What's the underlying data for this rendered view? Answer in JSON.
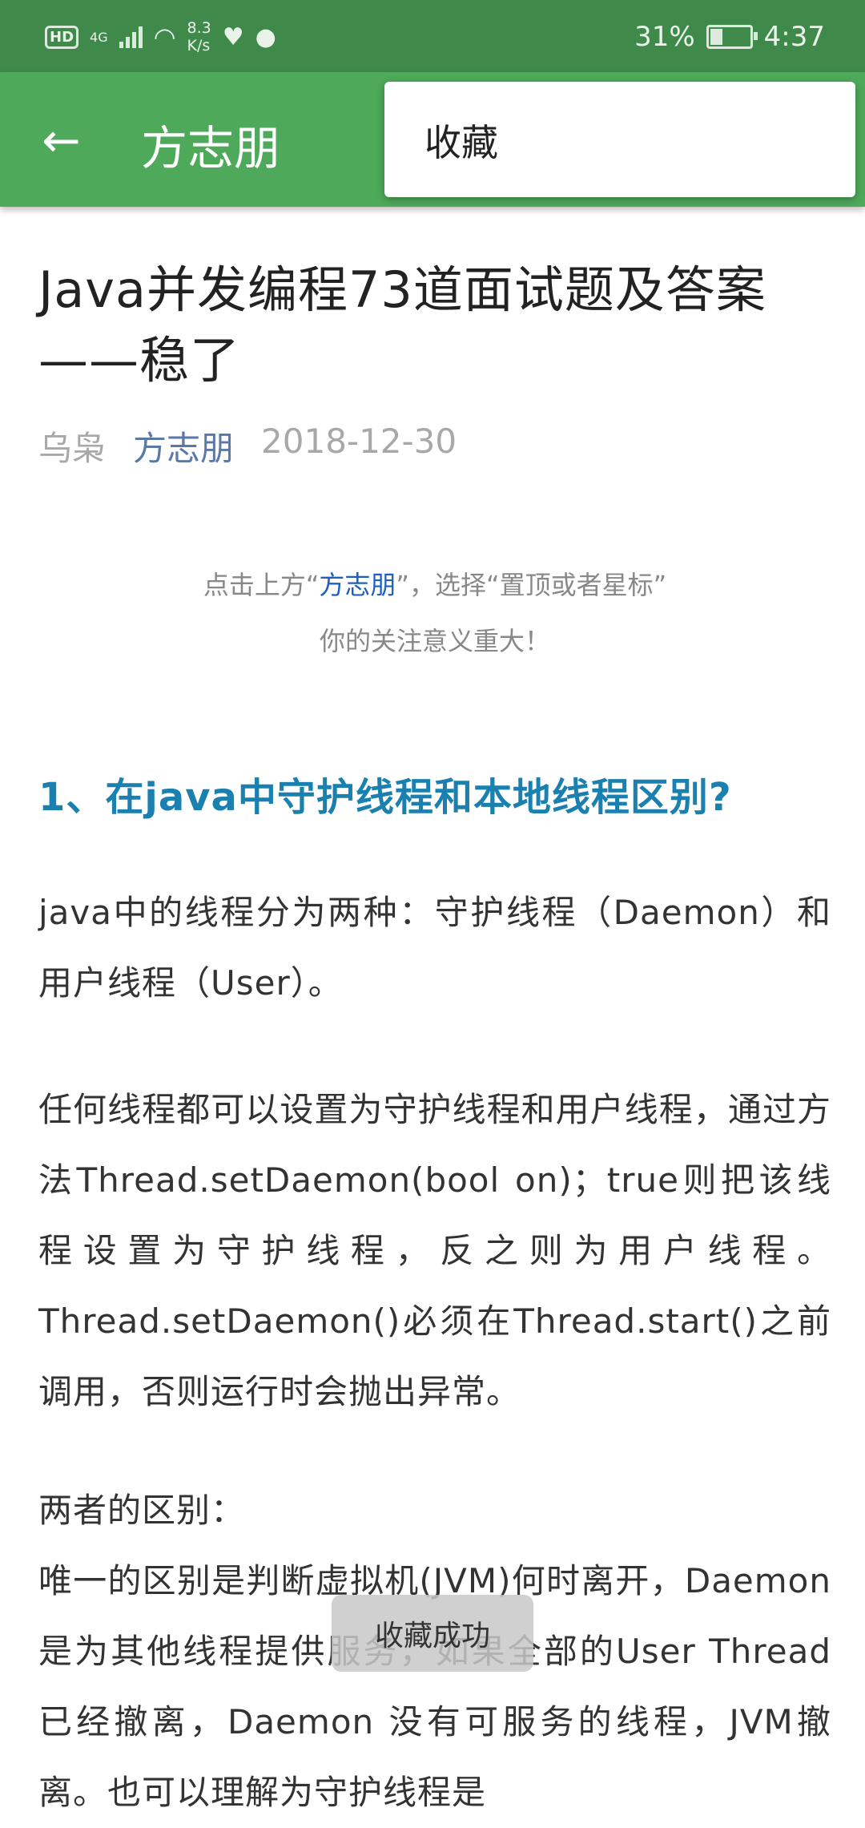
{
  "status_bar": {
    "hd_label": "HD",
    "network": "4G",
    "speed_value": "8.3",
    "speed_unit": "K/s",
    "battery_percent": "31%",
    "time": "4:37"
  },
  "app_bar": {
    "title": "方志朋",
    "menu_item": "收藏"
  },
  "article": {
    "title": "Java并发编程73道面试题及答案——稳了",
    "source": "乌枭",
    "author": "方志朋",
    "date": "2018-12-30",
    "notice_prefix": "点击上方“",
    "notice_link": "方志朋",
    "notice_suffix": "”，选择“置顶或者星标”",
    "notice_line2": "你的关注意义重大！",
    "heading1": "1、在java中守护线程和本地线程区别?",
    "para1": "java中的线程分为两种：守护线程（Daemon）和用户线程（User）。",
    "para2": "任何线程都可以设置为守护线程和用户线程，通过方法Thread.setDaemon(bool on)；true则把该线程设置为守护线程，反之则为用户线程。Thread.setDaemon()必须在Thread.start()之前调用，否则运行时会抛出异常。",
    "para3_label": "两者的区别：",
    "para3": "唯一的区别是判断虚拟机(JVM)何时离开，Daemon是为其他线程提供服务，如果全部的User Thread已经撤离，Daemon 没有可服务的线程，JVM撤离。也可以理解为守护线程是"
  },
  "toast": "收藏成功",
  "colors": {
    "status_bar": "#3f8a4a",
    "app_bar": "#4ea95a",
    "heading": "#1a80b0",
    "link": "#1f5fc2"
  }
}
